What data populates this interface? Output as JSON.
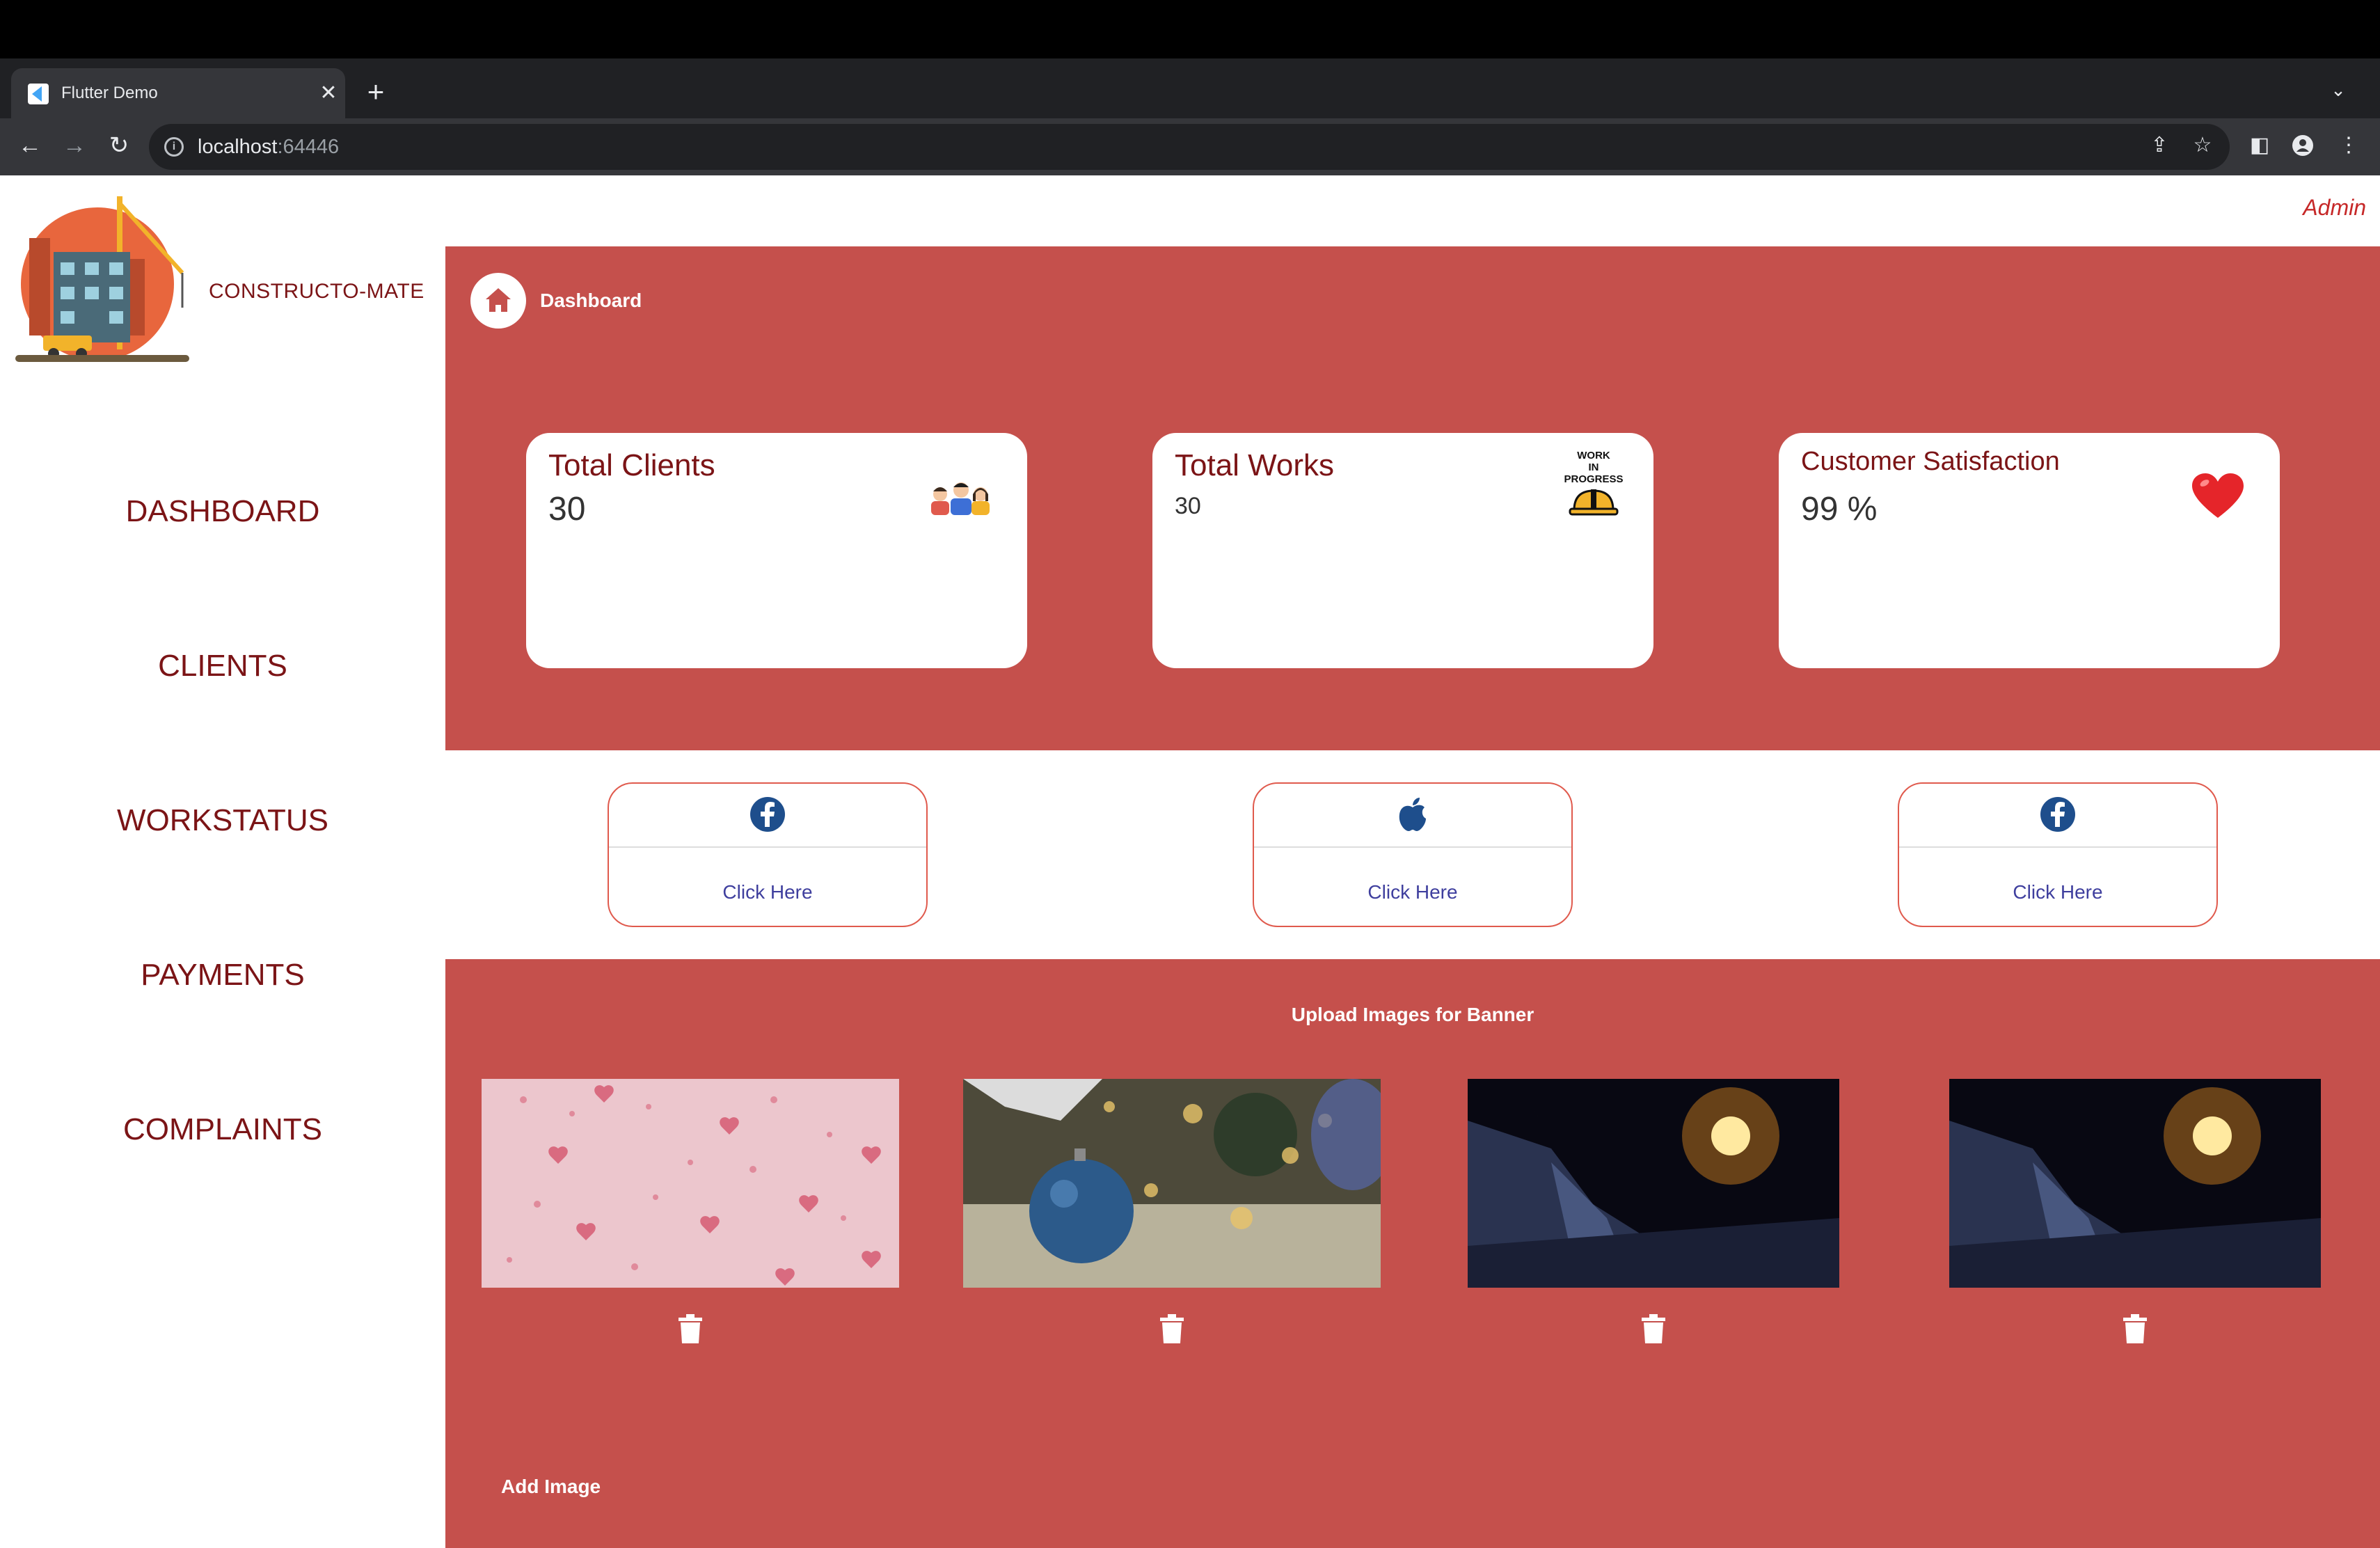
{
  "browser": {
    "tab_title": "Flutter Demo",
    "url_host": "localhost",
    "url_port": ":64446"
  },
  "header": {
    "user_label": "Admin"
  },
  "brand": {
    "name": "CONSTRUCTO-MATE"
  },
  "sidebar": {
    "items": [
      {
        "label": "DASHBOARD"
      },
      {
        "label": "CLIENTS"
      },
      {
        "label": "WORKSTATUS"
      },
      {
        "label": "PAYMENTS"
      },
      {
        "label": "COMPLAINTS"
      }
    ]
  },
  "breadcrumb": {
    "label": "Dashboard",
    "icon": "home-icon"
  },
  "stats": [
    {
      "title": "Total Clients",
      "value": "30",
      "icon": "clients-icon"
    },
    {
      "title": "Total Works",
      "value": "30",
      "icon": "work-in-progress-icon",
      "icon_text": [
        "WORK",
        "IN",
        "PROGRESS"
      ]
    },
    {
      "title": "Customer Satisfaction",
      "value": "99 %",
      "icon": "heart-icon"
    }
  ],
  "links": [
    {
      "icon": "facebook-icon",
      "label": "Click Here"
    },
    {
      "icon": "apple-icon",
      "label": "Click Here"
    },
    {
      "icon": "facebook-icon",
      "label": "Click Here"
    }
  ],
  "banner_section": {
    "title": "Upload Images for Banner",
    "add_label": "Add Image"
  },
  "colors": {
    "accent": "#c5504c",
    "brand_text": "#7b1416",
    "link_text": "#3f3f9e"
  }
}
